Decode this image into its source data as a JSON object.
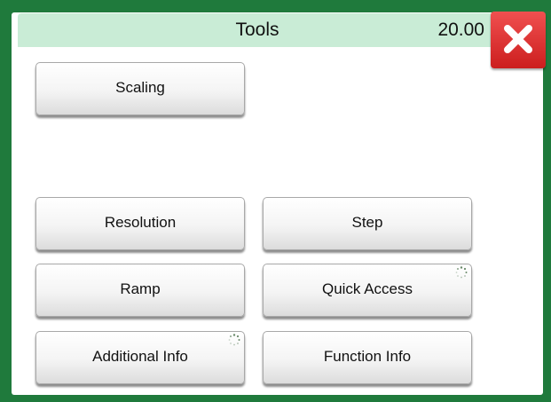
{
  "header": {
    "title": "Tools",
    "value": "20.00"
  },
  "close": {
    "icon": "close-icon",
    "color": "#e02a2a"
  },
  "buttons": {
    "scaling": "Scaling",
    "resolution": "Resolution",
    "step": "Step",
    "ramp": "Ramp",
    "quick_access": "Quick Access",
    "additional_info": "Additional Info",
    "function_info": "Function Info"
  },
  "colors": {
    "frame": "#1f7a3c",
    "titlebar": "#c9ecd6"
  }
}
